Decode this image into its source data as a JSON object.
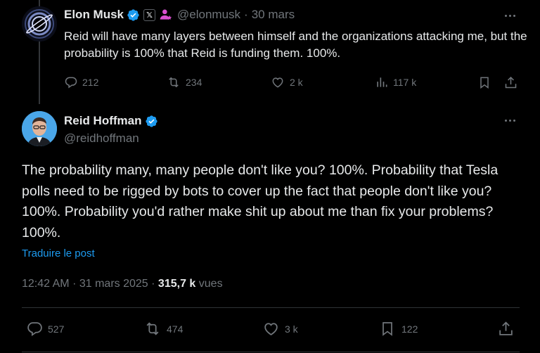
{
  "parent_tweet": {
    "author_name": "Elon Musk",
    "handle": "@elonmusk",
    "separator": "·",
    "date": "30 mars",
    "text": "Reid will have many layers between himself and the organizations attacking me, but the probability is 100% that Reid is funding them. 100%.",
    "actions": {
      "replies": "212",
      "reposts": "234",
      "likes": "2 k",
      "views": "117 k"
    }
  },
  "main_tweet": {
    "author_name": "Reid Hoffman",
    "handle": "@reidhoffman",
    "text": "The probability many, many people don't like you? 100%. Probability that Tesla polls need to be rigged by bots to cover up the fact that people don't like you? 100%. Probability you'd rather make shit up about me than fix your problems? 100%.",
    "translate_link": "Traduire le post",
    "time": "12:42 AM",
    "date": "31 mars 2025",
    "separator": "·",
    "views_count": "315,7 k",
    "views_label": "vues",
    "actions": {
      "replies": "527",
      "reposts": "474",
      "likes": "3 k",
      "bookmarks": "122"
    }
  },
  "colors": {
    "background": "#000000",
    "text": "#e7e9ea",
    "secondary": "#71767b",
    "accent": "#1d9bf0",
    "verified": "#1d9bf0",
    "affiliation": "#d94fd0",
    "divider": "#2f3336"
  },
  "icons": [
    "verified-badge-icon",
    "x-affiliation-icon",
    "affiliate-person-icon",
    "more-icon",
    "reply-icon",
    "repost-icon",
    "like-icon",
    "views-icon",
    "bookmark-icon",
    "share-icon"
  ]
}
